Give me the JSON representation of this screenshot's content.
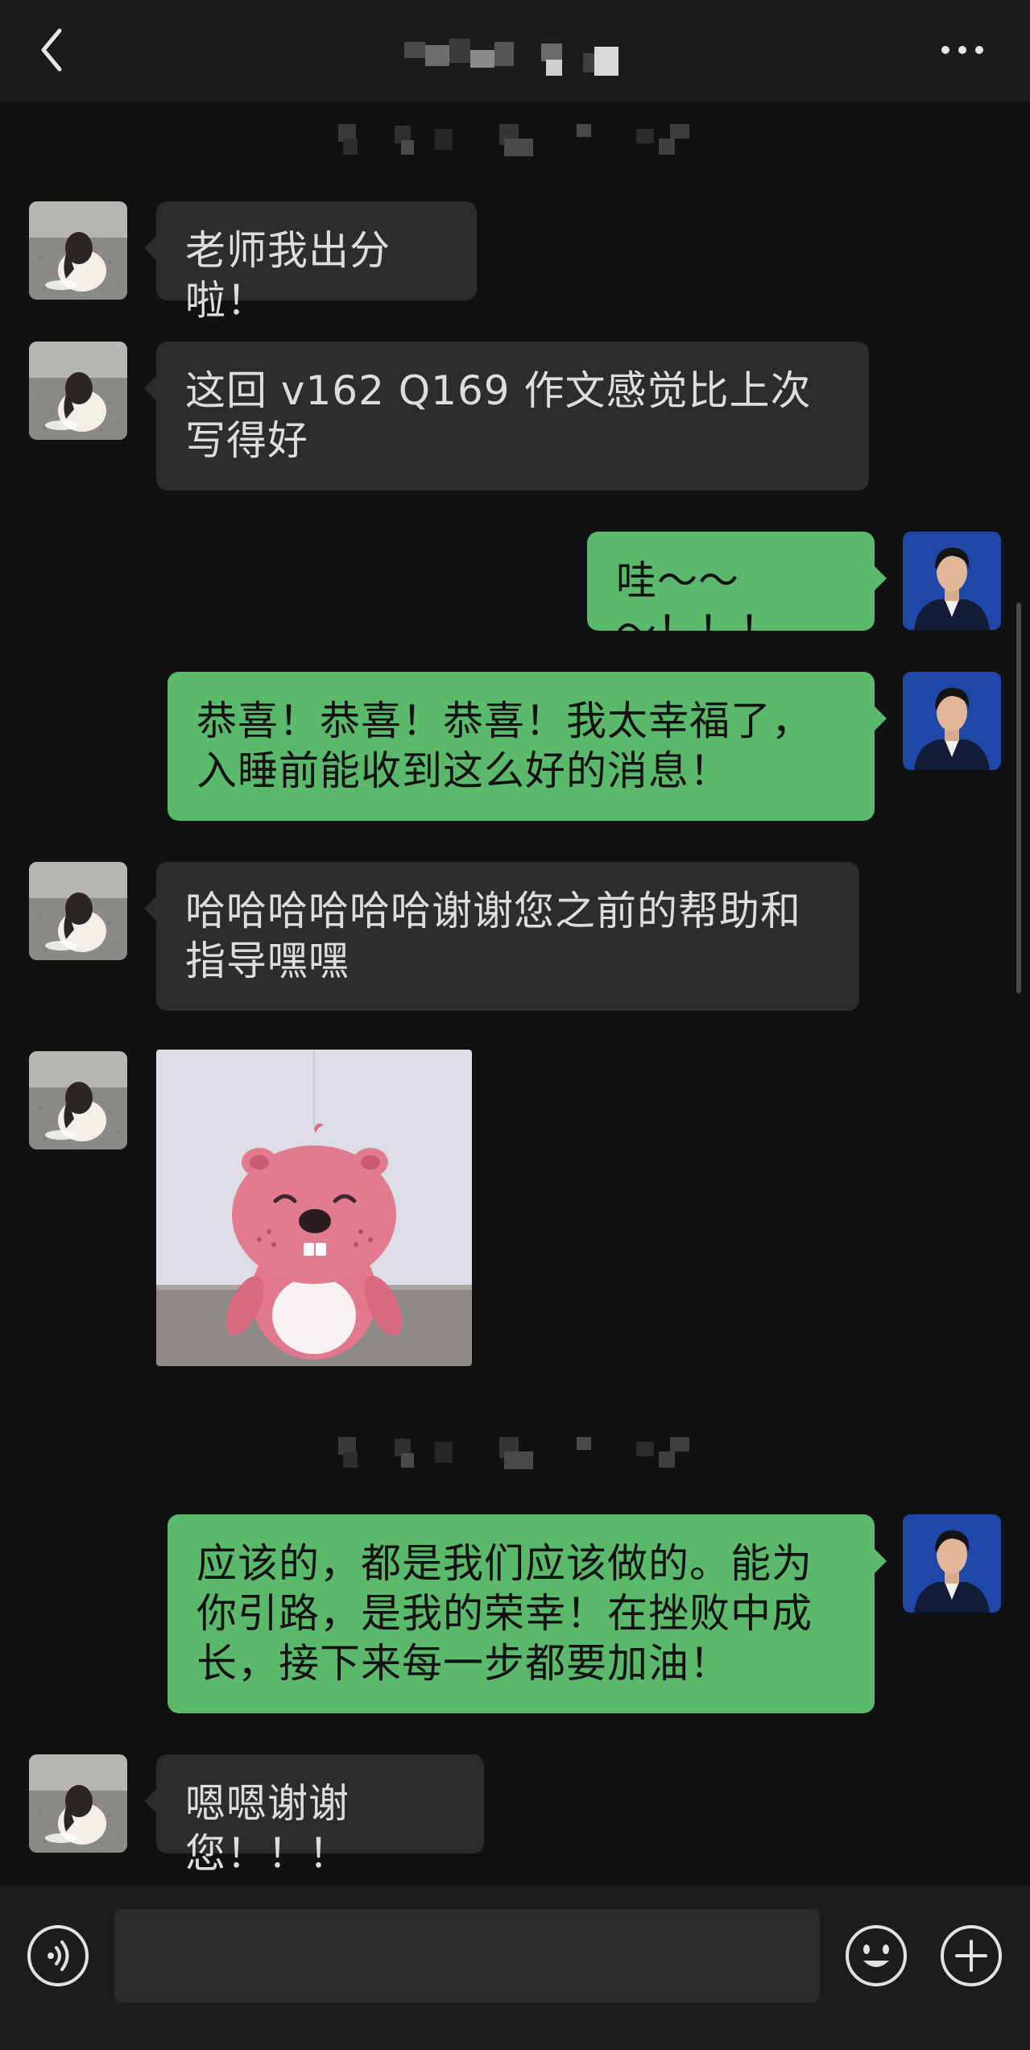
{
  "header": {
    "back_icon": "chevron-left-icon",
    "more_icon": "more-dots-icon",
    "title_pixelated": true
  },
  "messages": [
    {
      "side": "in",
      "type": "text",
      "text": "老师我出分啦！"
    },
    {
      "side": "in",
      "type": "text",
      "text": "这回 v162 Q169 作文感觉比上次写得好"
    },
    {
      "side": "out",
      "type": "text",
      "text": "哇～～～！！！"
    },
    {
      "side": "out",
      "type": "text",
      "text": "恭喜！恭喜！恭喜！我太幸福了，入睡前能收到这么好的消息！"
    },
    {
      "side": "in",
      "type": "text",
      "text": "哈哈哈哈哈哈谢谢您之前的帮助和指导嘿嘿"
    },
    {
      "side": "in",
      "type": "sticker",
      "sticker": "pink-beaver-sticker"
    },
    {
      "side": "out",
      "type": "text",
      "text": "应该的，都是我们应该做的。能为你引路，是我的荣幸！在挫败中成长，接下来每一步都要加油！"
    },
    {
      "side": "in",
      "type": "text",
      "text": "嗯嗯谢谢您！！！"
    }
  ],
  "input_bar": {
    "voice_icon": "voice-icon",
    "emoji_icon": "emoji-icon",
    "plus_icon": "plus-icon",
    "text_value": ""
  },
  "colors": {
    "background": "#111111",
    "incoming_bubble": "#2c2c2c",
    "outgoing_bubble": "#5ab96b",
    "header": "#1b1b1b"
  }
}
